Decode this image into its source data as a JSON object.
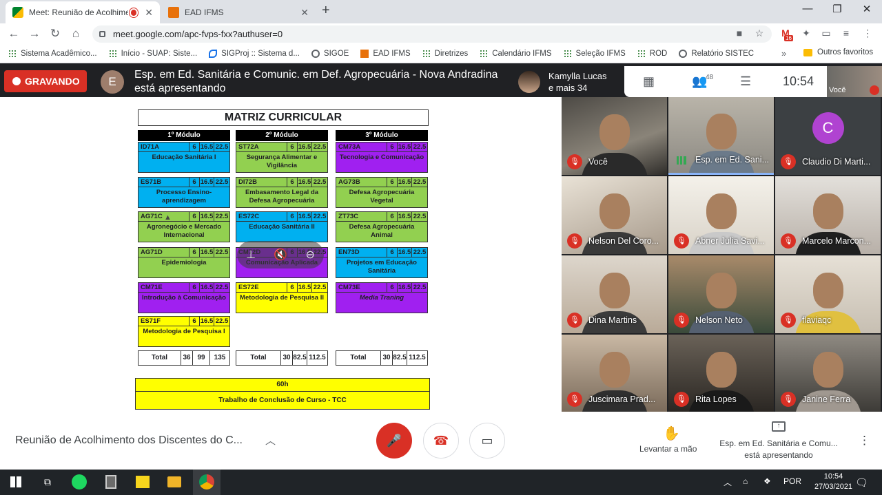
{
  "browser": {
    "tabs": [
      {
        "title": "Meet: Reunião de Acolhimen",
        "active": true
      },
      {
        "title": "EAD IFMS",
        "active": false
      }
    ],
    "url": "meet.google.com/apc-fvps-fxx?authuser=0",
    "extension_badge": "16",
    "bookmarks": [
      "Sistema Acadêmico...",
      "Início - SUAP: Siste...",
      "SIGProj :: Sistema d...",
      "SIGOE",
      "EAD IFMS",
      "Diretrizes",
      "Calendário IFMS",
      "Seleção IFMS",
      "ROD",
      "Relatório SISTEC"
    ],
    "bookmarks_more": "»",
    "other_bookmarks": "Outros favoritos"
  },
  "meet": {
    "recording_label": "GRAVANDO",
    "presenter_initial": "E",
    "presenter_title": "Esp. em Ed. Sanitária e Comunic. em Def. Agropecuária - Nova Andradina está apresentando",
    "pinned_name_line1": "Kamylla Lucas",
    "pinned_name_line2": "e mais 34",
    "people_count": "48",
    "clock": "10:54",
    "self_label": "Você",
    "meeting_title": "Reunião de Acolhimento dos Discentes do C...",
    "raise_hand_label": "Levantar a mão",
    "presenting_label_line1": "Esp. em Ed. Sanitária e Comu...",
    "presenting_label_line2": "está apresentando",
    "participants": [
      {
        "name": "Você",
        "muted": true
      },
      {
        "name": "Esp. em Ed. Sani...",
        "muted": false,
        "speaking": true
      },
      {
        "name": "Claudio Di Marti...",
        "muted": true,
        "initial": "C"
      },
      {
        "name": "Nelson Del Coro...",
        "muted": true
      },
      {
        "name": "Abner Julia Savi...",
        "muted": true
      },
      {
        "name": "Marcelo Marcon...",
        "muted": true
      },
      {
        "name": "Dina Martins",
        "muted": true
      },
      {
        "name": "Nelson Neto",
        "muted": true
      },
      {
        "name": "flaviaqc",
        "muted": true
      },
      {
        "name": "Juscimara Prad...",
        "muted": true
      },
      {
        "name": "Rita Lopes",
        "muted": true
      },
      {
        "name": "Janine Ferra",
        "muted": true
      }
    ]
  },
  "slide": {
    "title": "MATRIZ CURRICULAR",
    "modules": [
      {
        "header": "1º Módulo",
        "courses": [
          {
            "code": "ID71A",
            "a": "6",
            "b": "16.5",
            "c": "22.5",
            "name": "Educação Sanitária I",
            "color": "blue"
          },
          {
            "code": "ES71B",
            "a": "6",
            "b": "16.5",
            "c": "22.5",
            "name": "Processo Ensino-aprendizagem",
            "color": "blue"
          },
          {
            "code": "AG71C",
            "a": "6",
            "b": "16.5",
            "c": "22.5",
            "name": "Agronegócio e Mercado Internacional",
            "color": "green"
          },
          {
            "code": "AG71D",
            "a": "6",
            "b": "16.5",
            "c": "22.5",
            "name": "Epidemiologia",
            "color": "green"
          },
          {
            "code": "CM71E",
            "a": "6",
            "b": "16.5",
            "c": "22.5",
            "name": "Introdução à Comunicação",
            "color": "purple"
          },
          {
            "code": "ES71F",
            "a": "6",
            "b": "16.5",
            "c": "22.5",
            "name": "Metodologia de Pesquisa I",
            "color": "yellow"
          }
        ],
        "total": {
          "label": "Total",
          "a": "36",
          "b": "99",
          "c": "135"
        }
      },
      {
        "header": "2º Módulo",
        "courses": [
          {
            "code": "ST72A",
            "a": "6",
            "b": "16.5",
            "c": "22.5",
            "name": "Segurança Alimentar e Vigilância",
            "color": "green"
          },
          {
            "code": "DI72B",
            "a": "6",
            "b": "16.5",
            "c": "22.5",
            "name": "Embasamento Legal da Defesa Agropecuária",
            "color": "green"
          },
          {
            "code": "ES72C",
            "a": "6",
            "b": "16.5",
            "c": "22.5",
            "name": "Educação Sanitária II",
            "color": "blue"
          },
          {
            "code": "CM72D",
            "a": "6",
            "b": "16.5",
            "c": "22.5",
            "name": "Comunicação Aplicada",
            "color": "purple"
          },
          {
            "code": "ES72E",
            "a": "6",
            "b": "16.5",
            "c": "22.5",
            "name": "Metodologia de Pesquisa II",
            "color": "yellow"
          }
        ],
        "total": {
          "label": "Total",
          "a": "30",
          "b": "82.5",
          "c": "112.5"
        }
      },
      {
        "header": "3º Módulo",
        "courses": [
          {
            "code": "CM73A",
            "a": "6",
            "b": "16.5",
            "c": "22.5",
            "name": "Tecnologia e Comunicação",
            "color": "purple"
          },
          {
            "code": "AG73B",
            "a": "6",
            "b": "16.5",
            "c": "22.5",
            "name": "Defesa Agropecuária Vegetal",
            "color": "green"
          },
          {
            "code": "ZT73C",
            "a": "6",
            "b": "16.5",
            "c": "22.5",
            "name": "Defesa Agropecuária Animal",
            "color": "green"
          },
          {
            "code": "EN73D",
            "a": "6",
            "b": "16.5",
            "c": "22.5",
            "name": "Projetos em Educação Sanitária",
            "color": "blue"
          },
          {
            "code": "CM73E",
            "a": "6",
            "b": "16.5",
            "c": "22.5",
            "name": "Media Traning",
            "color": "purple"
          }
        ],
        "total": {
          "label": "Total",
          "a": "30",
          "b": "82.5",
          "c": "112.5"
        }
      }
    ],
    "tcc_hours": "60h",
    "tcc_name": "Trabalho de Conclusão de Curso - TCC"
  },
  "taskbar": {
    "language": "POR",
    "time": "10:54",
    "date": "27/03/2021"
  },
  "colors": {
    "blue": "#00b0f0",
    "green": "#92d050",
    "purple": "#a020f0",
    "yellow": "#ffff00",
    "record_red": "#d93025"
  }
}
